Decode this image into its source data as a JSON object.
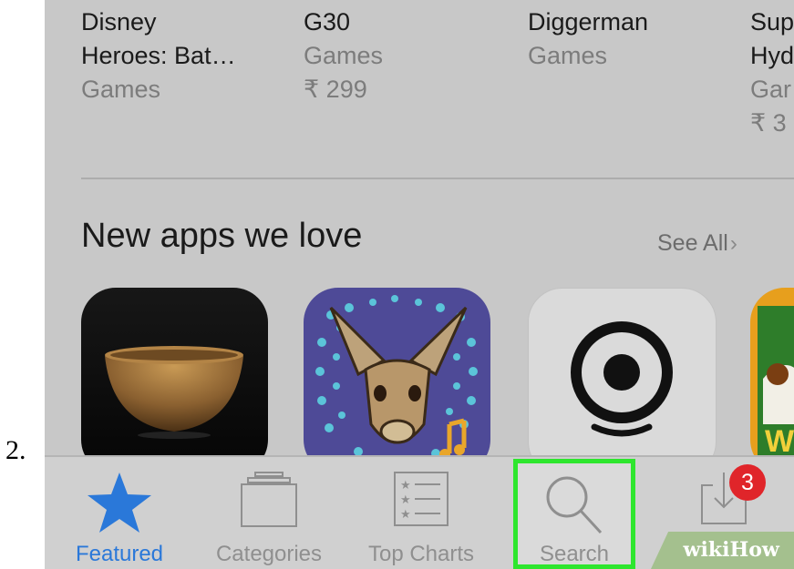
{
  "step_number": "2.",
  "top_row": [
    {
      "name": "Disney\nHeroes: Bat…",
      "category": "Games",
      "price": ""
    },
    {
      "name": "G30",
      "category": "Games",
      "price": "₹ 299"
    },
    {
      "name": "Diggerman",
      "category": "Games",
      "price": ""
    },
    {
      "name": "Sup\nHyd",
      "category": "Gar",
      "price": "₹ 3"
    }
  ],
  "section": {
    "title": "New apps we love",
    "see_all": "See All",
    "see_all_chevron": "›"
  },
  "tiles": [
    {
      "icon": "singing-bowl-icon"
    },
    {
      "icon": "kangaroo-icon"
    },
    {
      "icon": "target-face-icon"
    },
    {
      "icon": "cartoon-character-icon"
    }
  ],
  "tabbar": {
    "featured": "Featured",
    "categories": "Categories",
    "top_charts": "Top Charts",
    "search": "Search",
    "updates_badge": "3"
  },
  "watermark": "wikiHow",
  "colors": {
    "accent": "#2a78d9",
    "highlight": "#2ee62e",
    "badge": "#e0252a"
  }
}
